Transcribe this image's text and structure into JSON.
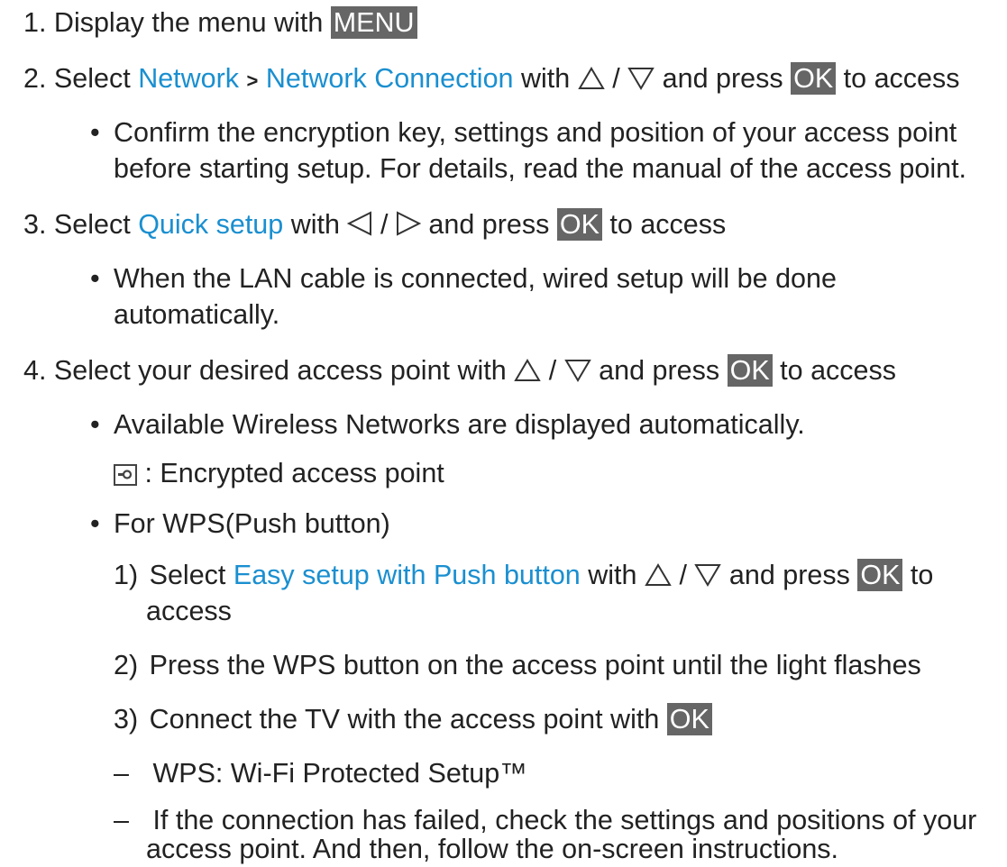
{
  "steps": [
    {
      "num": "1.",
      "text": "Display the menu with",
      "key": "MENU"
    },
    {
      "num": "2.",
      "pre": "Select",
      "link1": "Network",
      "sep": ">",
      "link2": "Network Connection",
      "with": "with",
      "slash": "/",
      "mid": "and press",
      "key": "OK",
      "post": "to access"
    },
    {
      "num": "3.",
      "pre": "Select",
      "link": "Quick setup",
      "with": "with",
      "slash": "/",
      "mid": "and press",
      "key": "OK",
      "post": "to access"
    },
    {
      "num": "4.",
      "pre": "Select your desired access point with",
      "slash": "/",
      "mid": "and press",
      "key": "OK",
      "post": "to access"
    }
  ],
  "notes": {
    "n2_line1": "Confirm the encryption key, settings and position of your access point",
    "n2_line2": "before starting setup. For details, read the manual of the access point.",
    "n3_line1": "When the LAN cable is connected, wired setup will be done",
    "n3_line2": "automatically.",
    "n4a": "Available Wireless Networks are displayed automatically.",
    "n4_lock": ": Encrypted access point",
    "n4b": "For WPS(Push button)"
  },
  "wps": {
    "s1_num": "1)",
    "s1_pre": "Select",
    "s1_link": "Easy setup with Push button",
    "s1_with": "with",
    "s1_slash": "/",
    "s1_mid": "and press",
    "s1_key": "OK",
    "s1_post": "to",
    "s1_line2": "access",
    "s2_num": "2)",
    "s2": "Press the WPS button on the access point until the light flashes",
    "s3_num": "3)",
    "s3": "Connect the TV with the access point with",
    "s3_key": "OK"
  },
  "dashes": {
    "d1": "WPS: Wi-Fi Protected Setup™",
    "d2_line1": "If the connection has failed, check the settings and positions of your",
    "d2_line2": "access point. And then, follow the on-screen instructions."
  },
  "symbols": {
    "bullet": "•",
    "dash": "–"
  },
  "icons": [
    "up-triangle-icon",
    "down-triangle-icon",
    "left-triangle-icon",
    "right-triangle-icon",
    "lock-icon"
  ],
  "colors": {
    "link": "#1a8fd0",
    "key_bg": "#666666",
    "text": "#222222"
  }
}
